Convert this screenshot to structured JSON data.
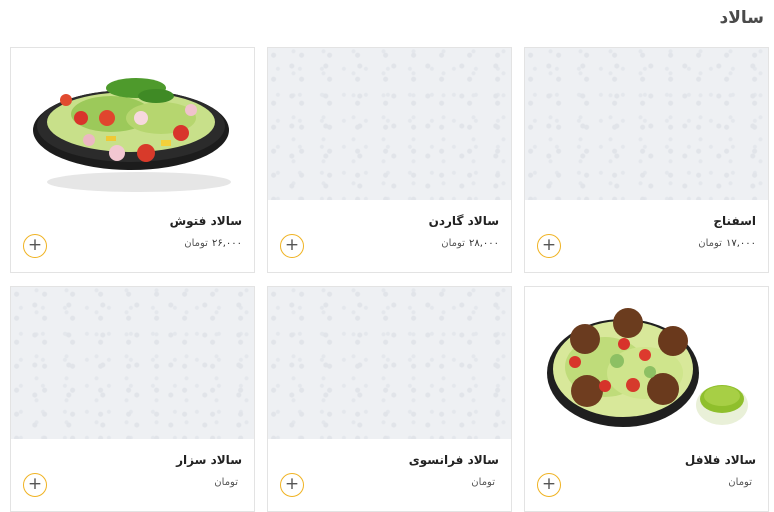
{
  "section": {
    "title": "سالاد"
  },
  "currency": "تومان",
  "cards": [
    {
      "name": "اسفناج",
      "price": "۱۷,۰۰۰",
      "image": "placeholder"
    },
    {
      "name": "سالاد گاردن",
      "price": "۲۸,۰۰۰",
      "image": "placeholder"
    },
    {
      "name": "سالاد فتوش",
      "price": "۲۶,۰۰۰",
      "image": "fattoush-salad-photo"
    },
    {
      "name": "سالاد فلافل",
      "price": "",
      "image": "falafel-salad-photo"
    },
    {
      "name": "سالاد فرانسوی",
      "price": "",
      "image": "placeholder"
    },
    {
      "name": "سالاد سزار",
      "price": "",
      "image": "placeholder"
    }
  ],
  "icons": {
    "add": "plus-icon"
  },
  "colors": {
    "accent": "#f0b323",
    "placeholder_bg": "#eef0f3"
  }
}
